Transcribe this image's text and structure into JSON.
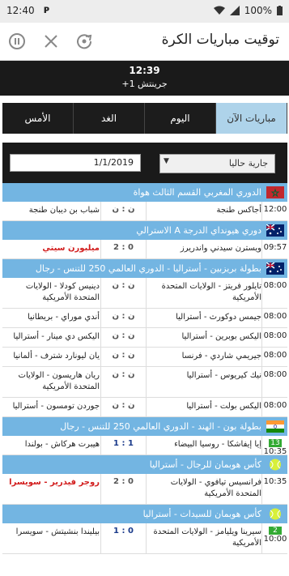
{
  "status_bar": {
    "time": "12:40",
    "battery": "100%"
  },
  "app_bar": {
    "title": "توقيت مباريات الكرة"
  },
  "timebar": {
    "clock": "12:39",
    "timezone": "جرينتش 1+"
  },
  "tabs": [
    {
      "label": "مباريات الآن",
      "active": true
    },
    {
      "label": "اليوم",
      "active": false
    },
    {
      "label": "الغد",
      "active": false
    },
    {
      "label": "الأمس",
      "active": false
    }
  ],
  "filter": {
    "status_select": "جارية حاليا",
    "date": "1/1/2019"
  },
  "groups": [
    {
      "league": "الدوري المغربي القسم الثالث هواة",
      "flag": "morocco",
      "matches": [
        {
          "time": "12:00",
          "home": "أجاكس طنجة",
          "score": "ن : ن",
          "away": "شباب بن ديبان طنجة",
          "rows": 1
        }
      ]
    },
    {
      "league": "دوري هيونداي الدرجة A الاسترالي",
      "flag": "australia",
      "matches": [
        {
          "time": "09:57",
          "home": "ويسترن سيدني واندريرز",
          "score": "2 : 0",
          "away": "ميلبورن سيتي",
          "rows": 1,
          "red": true
        }
      ]
    },
    {
      "league": "بطولة بريزبين - أستراليا - الدوري العالمي 250 للتنس - رجال",
      "flag": "australia",
      "matches": [
        {
          "time": "08:00",
          "home": "تايلور فريتز - الولايات المتحدة الأمريكية",
          "score": "ن : ن",
          "away": "دينيس كودلا - الولايات المتحدة الأمريكية",
          "rows": 2
        },
        {
          "time": "08:00",
          "home": "جيمس دوكورث - أستراليا",
          "score": "ن : ن",
          "away": "أندي موراي - بريطانيا",
          "rows": 1
        },
        {
          "time": "08:00",
          "home": "اليكس بوبرين - أستراليا",
          "score": "ن : ن",
          "away": "اليكس دي مينار - أستراليا",
          "rows": 1
        },
        {
          "time": "08:00",
          "home": "جيريمي شاردي - فرنسا",
          "score": "ن : ن",
          "away": "يان ليونارد شترف - ألمانيا",
          "rows": 1
        },
        {
          "time": "08:00",
          "home": "نيك كيريوس - أستراليا",
          "score": "ن : ن",
          "away": "ريان هاريسون - الولايات المتحدة الأمريكية",
          "rows": 2
        },
        {
          "time": "08:00",
          "home": "اليكس بولت - أستراليا",
          "score": "ن : ن",
          "away": "جوردن تومسون - أستراليا",
          "rows": 1
        }
      ]
    },
    {
      "league": "بطولة بون - الهند - الدوري العالمي 250 للتنس - رجال",
      "flag": "india",
      "matches": [
        {
          "time": "10:35",
          "badge": "13",
          "home": "إيا إيفاشكا - روسيا البيضاء",
          "score": "1 : 1",
          "away": "هيبرت هركاش - بولندا",
          "rows": 1,
          "blue": true
        }
      ]
    },
    {
      "league": "كأس هوبمان للرجال - أستراليا",
      "flag": "tennis",
      "matches": [
        {
          "time": "10:35",
          "home": "فرانسيس تيافوي - الولايات المتحدة الأمريكية",
          "score": "2 : 0",
          "away": "روجر فيدرير - سويسرا",
          "rows": 2,
          "red": true
        }
      ]
    },
    {
      "league": "كأس هوبمان للسيدات - أستراليا",
      "flag": "tennis",
      "matches": [
        {
          "time": "10:00",
          "badge": "2",
          "home": "سيرينا ويليامز - الولايات المتحدة الأمريكية",
          "score": "1 : 0",
          "away": "بيليندا بنشيتش - سويسرا",
          "rows": 2,
          "blue": true
        }
      ]
    }
  ]
}
